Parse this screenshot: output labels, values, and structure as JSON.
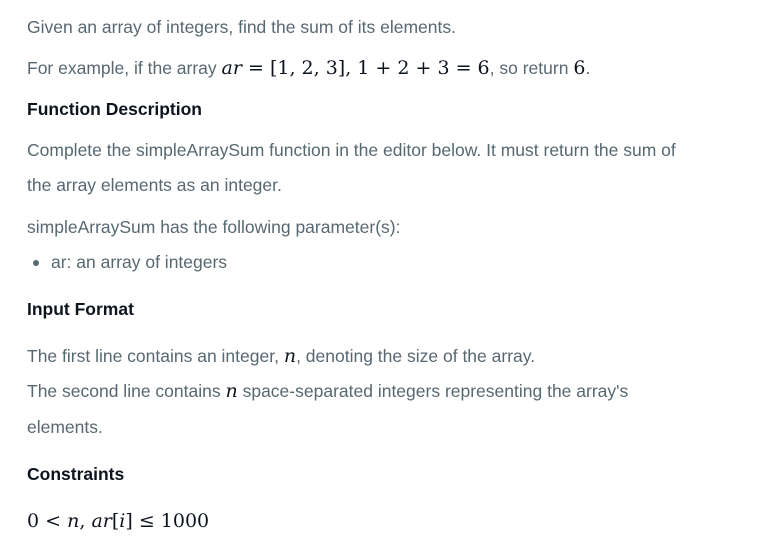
{
  "intro": "Given an array of integers, find the sum of its elements.",
  "example": {
    "prefix": "For example, if the array",
    "var": "ar",
    "equals": " = ",
    "array": "[1, 2, 3]",
    "comma": ", ",
    "expression": "1 + 2 + 3 = 6",
    "suffix": ", so return",
    "result": "6",
    "period": "."
  },
  "function_description": {
    "heading": "Function Description",
    "text_line1": "Complete the simpleArraySum function in the editor below. It must return the sum of",
    "text_line2": "the array elements as an integer.",
    "params_intro": "simpleArraySum has the following parameter(s):",
    "params": [
      "ar: an array of integers"
    ]
  },
  "input_format": {
    "heading": "Input Format",
    "line1_prefix": "The first line contains an integer,",
    "line1_var": "n",
    "line1_suffix": ", denoting the size of the array.",
    "line2_prefix": "The second line contains",
    "line2_var": "n",
    "line2_suffix": "space-separated integers representing the array's",
    "line3": "elements."
  },
  "constraints": {
    "heading": "Constraints",
    "formula_left": "0 < ",
    "var_n": "n",
    "sep": ", ",
    "var_ar": "ar",
    "bracket_open": "[",
    "var_i": "i",
    "bracket_close": "]",
    "formula_right": " ≤ 1000"
  }
}
